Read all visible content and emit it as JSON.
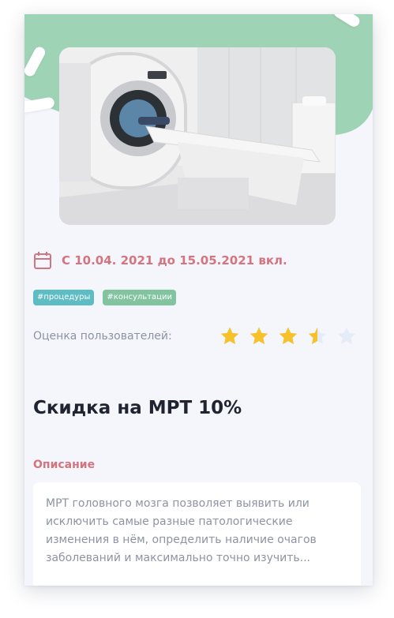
{
  "promo": {
    "date_text": "С 10.04. 2021 до 15.05.2021 вкл.",
    "tags": [
      "#процедуры",
      "#консультации"
    ],
    "rating_label": "Оценка пользователей:",
    "rating_value": 3.5,
    "rating_max": 5,
    "title": "Скидка на МРТ 10%",
    "description_label": "Описание",
    "description_lines": [
      "МРТ головного мозга позволяет выявить или",
      "исключить самые разные патологические",
      "изменения в нём, определить наличие очагов",
      "заболеваний и максимально точно изучить..."
    ]
  },
  "colors": {
    "accent": "#d3757f",
    "mint": "#9fd3b6",
    "star_filled": "#f6c12a",
    "star_empty": "#e6ecf7",
    "tag1": "#5dbcc4",
    "tag2": "#82c4a0"
  },
  "icons": {
    "date": "calendar-icon",
    "rating": "star-icon",
    "photo": "mri-machine-photo"
  }
}
